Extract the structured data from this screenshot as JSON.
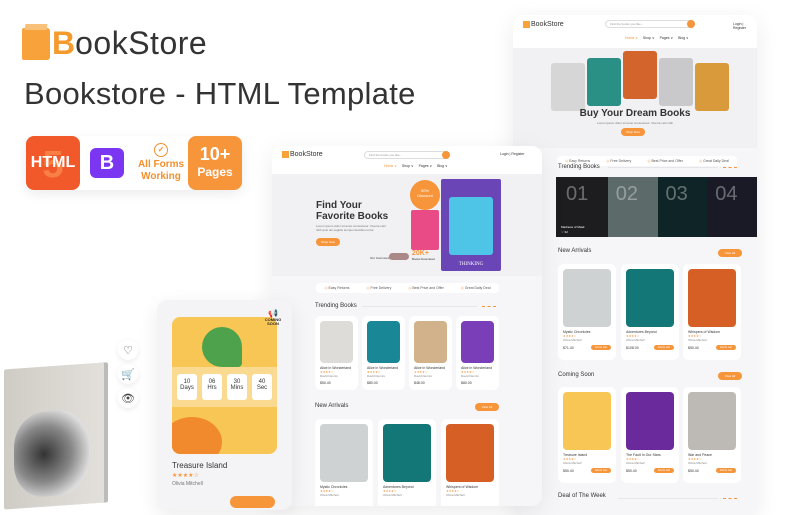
{
  "brand": {
    "logo_first": "B",
    "logo_rest": "ookStore",
    "subtitle": "Bookstore -  HTML Template"
  },
  "badges": [
    {
      "label": "HTML",
      "icon": "html5-icon"
    },
    {
      "label": "B",
      "icon": "bootstrap-icon"
    },
    {
      "line1": "All Forms",
      "line2": "Working",
      "icon": "check-badge-icon"
    },
    {
      "line1": "10+",
      "line2": "Pages"
    }
  ],
  "colors": {
    "accent": "#f7953b",
    "html": "#f1592a",
    "bootstrap": "#7b36f2"
  },
  "mockup_right": {
    "logo": "BookStore",
    "search_placeholder": "Find the books you like...",
    "menu": [
      "Home ∨",
      "Shop ∨",
      "Pages ∨",
      "Blog ∨"
    ],
    "auth": "Login | Register",
    "hero_title": "Buy Your  Dream Books",
    "hero_sub": "Lorem ipsum dolor sit amet consectetur. Viverra velit nibh",
    "hero_button": "Shop Now",
    "features": [
      "Easy Returns",
      "Free Delivery",
      "Best Price and Offer",
      "Great Daily Deal"
    ],
    "trending_title": "Trending Books",
    "trending_numbers": [
      "01",
      "02",
      "03",
      "04"
    ],
    "trending_caption": "Madness of Mask",
    "trending_likes": "♡ 32",
    "new_arrivals_title": "New Arrivals",
    "view_all": "View All",
    "new_arrivals": [
      {
        "title": "Mystic Chronicles",
        "stars": "★★★★☆",
        "author": "Olivia Mitchell",
        "price": "$71.40",
        "old": "$84.00",
        "button": "Add to cart"
      },
      {
        "title": "Adventures Beyond",
        "stars": "★★★★☆",
        "author": "Olivia Mitchell",
        "price": "$108.00",
        "old": "$120.00",
        "button": "Add to cart"
      },
      {
        "title": "Whispers of Wisdom",
        "stars": "★★★★☆",
        "author": "Olivia Mitchell",
        "price": "$50.40",
        "old": "$56.00",
        "button": "Add to cart"
      }
    ],
    "coming_soon_title": "Coming Soon",
    "coming_soon": [
      {
        "title": "Treasure Island",
        "stars": "★★★★☆",
        "author": "Olivia Mitchell",
        "price": "$50.40",
        "old": "$56.00",
        "button": "Add to cart"
      },
      {
        "title": "The Fault In Our Stars",
        "stars": "★★★★☆",
        "author": "Olivia Mitchell",
        "price": "$50.40",
        "old": "$56.00",
        "button": "Add to cart"
      },
      {
        "title": "War and Peace",
        "stars": "★★★★☆",
        "author": "Olivia Mitchell",
        "price": "$50.40",
        "old": "$56.00",
        "button": "Add to cart"
      }
    ],
    "deal_title": "Deal of The Week"
  },
  "mockup_mid": {
    "logo": "BookStore",
    "search_placeholder": "Find the books you like...",
    "menu": [
      "Home ∨",
      "Shop ∨",
      "Pages ∨",
      "Blog ∨"
    ],
    "auth": "Login | Register",
    "hero_title_1": "Find Your",
    "hero_title_2": "Favorite Books",
    "hero_sub": "Lorem ipsum dolor sit amet consectetur. Viverra velit nibh quis dui sagittis tempus faucibus tortor.",
    "hero_button": "Shop Now",
    "discount": "50%",
    "discount_label": "Discount",
    "community": "Our Community",
    "count": "20K+",
    "count_label": "Books Download",
    "book_title": "THINKING",
    "features": [
      "Easy Returns",
      "Free Delivery",
      "Best Price and Offer",
      "Great Daily Deal"
    ],
    "trending_title": "Trending Books",
    "trending": [
      {
        "title": "Alice in Wonderland",
        "stars": "★★★★☆",
        "author": "David Dennis",
        "price": "$50.40",
        "old": "$56.00"
      },
      {
        "title": "Alice in Wonderland",
        "stars": "★★★★☆",
        "author": "David Dennis",
        "price": "$80.00",
        "old": ""
      },
      {
        "title": "Alice in Wonderland",
        "stars": "★★★★☆",
        "author": "David Dennis",
        "price": "$48.00",
        "old": "$52.00"
      },
      {
        "title": "Alice in Wonderland",
        "stars": "★★★★☆",
        "author": "David Dennis",
        "price": "$80.00",
        "old": ""
      }
    ],
    "new_arrivals_title": "New Arrivals",
    "view_all": "View All",
    "new_arrivals": [
      {
        "title": "Mystic Chronicles",
        "stars": "★★★★☆",
        "author": "Olivia Mitchell"
      },
      {
        "title": "Adventures Beyond",
        "stars": "★★★★☆",
        "author": "Olivia Mitchell"
      },
      {
        "title": "Whispers of Wisdom",
        "stars": "★★★★☆",
        "author": "Olivia Mitchell"
      }
    ]
  },
  "phone_card": {
    "coming_soon_stamp": "COMING SOON",
    "countdown": [
      {
        "value": "10",
        "unit": "Days"
      },
      {
        "value": "06",
        "unit": "Hrs"
      },
      {
        "value": "30",
        "unit": "Mins"
      },
      {
        "value": "40",
        "unit": "Sec"
      }
    ],
    "title": "Treasure Island",
    "stars": "★★★★☆",
    "author": "Olivia Mitchell"
  },
  "side_icons": [
    "heart-icon",
    "cart-icon",
    "eye-icon"
  ]
}
